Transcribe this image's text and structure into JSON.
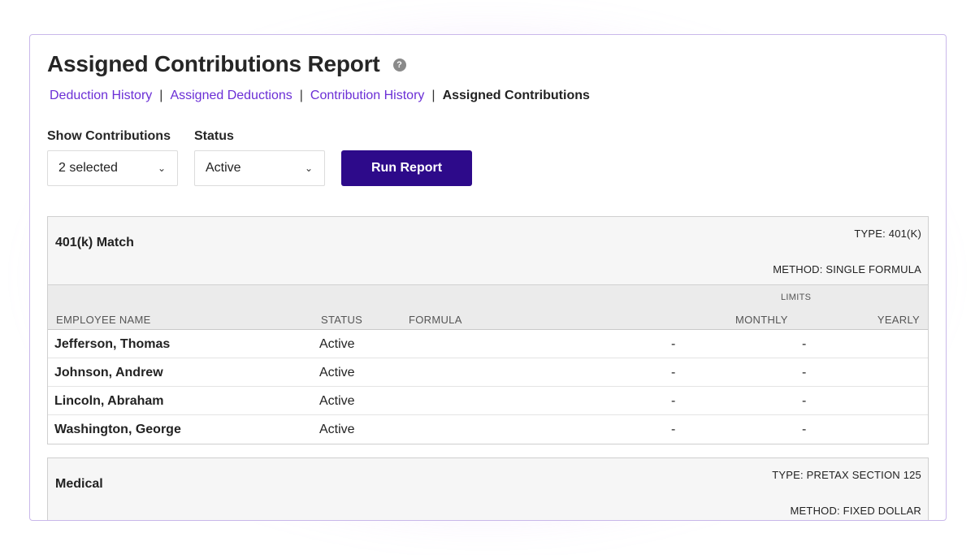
{
  "header": {
    "title": "Assigned Contributions Report",
    "help_icon": "question-circle-icon"
  },
  "nav": {
    "links": [
      "Deduction History",
      "Assigned Deductions",
      "Contribution History"
    ],
    "current": "Assigned Contributions",
    "separator": "|"
  },
  "filters": {
    "show_label": "Show Contributions",
    "show_value": "2 selected",
    "status_label": "Status",
    "status_value": "Active",
    "run_label": "Run Report",
    "dropdown_icon": "chevron-down-icon"
  },
  "columns": {
    "limits": "LIMITS",
    "name": "EMPLOYEE NAME",
    "status": "STATUS",
    "formula": "FORMULA",
    "monthly": "MONTHLY",
    "yearly": "YEARLY"
  },
  "groups": [
    {
      "name": "401(k) Match",
      "type": "TYPE: 401(K)",
      "method": "METHOD: SINGLE FORMULA",
      "rows": [
        {
          "name": "Jefferson, Thomas",
          "status": "Active",
          "monthly": "-",
          "yearly": "-"
        },
        {
          "name": "Johnson, Andrew",
          "status": "Active",
          "monthly": "-",
          "yearly": "-"
        },
        {
          "name": "Lincoln, Abraham",
          "status": "Active",
          "monthly": "-",
          "yearly": "-"
        },
        {
          "name": "Washington, George",
          "status": "Active",
          "monthly": "-",
          "yearly": "-"
        }
      ]
    },
    {
      "name": "Medical",
      "type": "TYPE: PRETAX SECTION 125",
      "method": "METHOD: FIXED DOLLAR"
    }
  ],
  "colors": {
    "accent": "#2d0a8a",
    "link": "#6b2fd6",
    "glow": "#b478f0"
  }
}
